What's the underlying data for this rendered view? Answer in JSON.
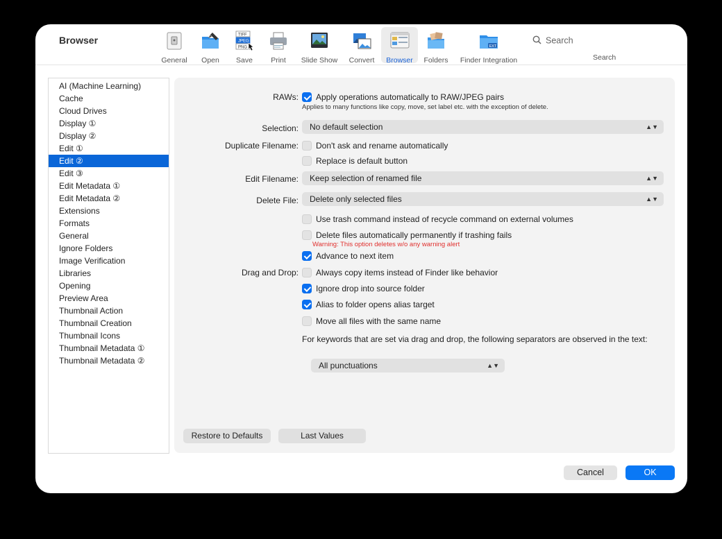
{
  "window": {
    "title": "Browser"
  },
  "toolbar": {
    "items": [
      {
        "label": "General",
        "icon": "general-icon"
      },
      {
        "label": "Open",
        "icon": "open-icon"
      },
      {
        "label": "Save",
        "icon": "save-icon"
      },
      {
        "label": "Print",
        "icon": "print-icon"
      },
      {
        "label": "Slide Show",
        "icon": "slide-show-icon"
      },
      {
        "label": "Convert",
        "icon": "convert-icon"
      },
      {
        "label": "Browser",
        "icon": "browser-icon"
      },
      {
        "label": "Folders",
        "icon": "folders-icon"
      },
      {
        "label": "Finder Integration",
        "icon": "finder-integration-icon"
      }
    ],
    "active": "Browser",
    "search_placeholder": "Search",
    "search_label": "Search",
    "save_icon_text": [
      "TIFF",
      "JPEG",
      "PNG"
    ],
    "finder_icon_text": "EXT"
  },
  "sidebar": {
    "items": [
      "AI (Machine Learning)",
      "Cache",
      "Cloud Drives",
      "Display ①",
      "Display ②",
      "Edit ①",
      "Edit ②",
      "Edit ③",
      "Edit Metadata ①",
      "Edit Metadata ②",
      "Extensions",
      "Formats",
      "General",
      "Ignore Folders",
      "Image Verification",
      "Libraries",
      "Opening",
      "Preview Area",
      "Thumbnail Action",
      "Thumbnail Creation",
      "Thumbnail Icons",
      "Thumbnail Metadata ①",
      "Thumbnail Metadata ②"
    ],
    "selected": "Edit ②"
  },
  "settings": {
    "raws_label": "RAWs:",
    "raws_option": "Apply operations automatically to RAW/JPEG pairs",
    "raws_checked": true,
    "raws_note": "Applies to many functions like copy, move, set label etc. with the exception of delete.",
    "selection_label": "Selection:",
    "selection_value": "No default selection",
    "duplicate_label": "Duplicate Filename:",
    "duplicate_opt1": "Don't ask and rename automatically",
    "duplicate_opt1_checked": false,
    "duplicate_opt2": "Replace is default button",
    "duplicate_opt2_checked": false,
    "edit_filename_label": "Edit Filename:",
    "edit_filename_value": "Keep selection of renamed file",
    "delete_label": "Delete File:",
    "delete_value": "Delete only selected files",
    "trash_opt": "Use trash command instead of recycle command on external volumes",
    "trash_checked": false,
    "delete_perm_opt": "Delete files automatically permanently if trashing fails",
    "delete_perm_checked": false,
    "delete_warning": "Warning: This option deletes w/o any warning alert",
    "advance_opt": "Advance to next item",
    "advance_checked": true,
    "dragdrop_label": "Drag  and Drop:",
    "dd_opt1": "Always copy items instead of Finder like behavior",
    "dd_opt1_checked": false,
    "dd_opt2": "Ignore drop into source folder",
    "dd_opt2_checked": true,
    "dd_opt3": "Alias to folder opens alias target",
    "dd_opt3_checked": true,
    "dd_opt4": "Move all files with the same name",
    "dd_opt4_checked": false,
    "keywords_note": "For keywords that are set via drag and drop, the following separators are observed in the text:",
    "separator_value": "All punctuations",
    "restore_button": "Restore to Defaults",
    "last_values_button": "Last Values"
  },
  "footer": {
    "cancel": "Cancel",
    "ok": "OK"
  },
  "colors": {
    "accent": "#0a66d8",
    "checkbox_on": "#0a6ff0",
    "warning": "#e0302e"
  }
}
